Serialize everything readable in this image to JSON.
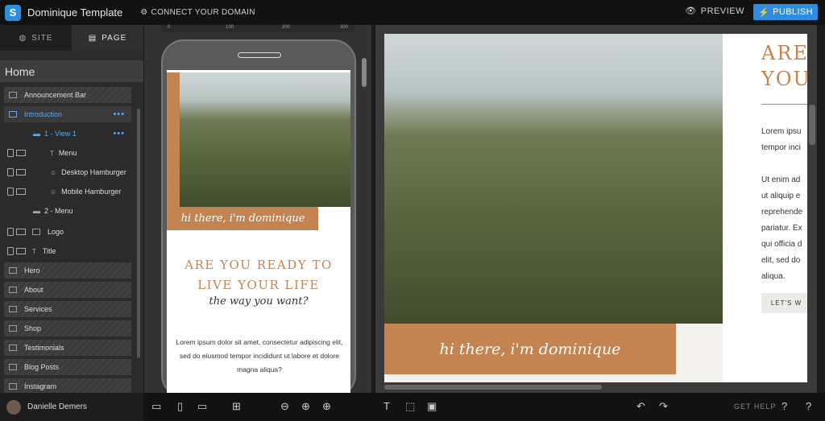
{
  "app": {
    "title": "Dominique Template",
    "connect_label": "CONNECT YOUR DOMAIN",
    "preview_label": "PREVIEW",
    "publish_label": "PUBLISH"
  },
  "sidebar": {
    "tabs": [
      {
        "label": "SITE"
      },
      {
        "label": "PAGE"
      }
    ],
    "page_title": "Home",
    "items": [
      {
        "label": "Announcement Bar"
      },
      {
        "label": "Introduction"
      },
      {
        "label": "1 - View 1"
      },
      {
        "label": "Menu"
      },
      {
        "label": "Desktop Hamburger"
      },
      {
        "label": "Mobile Hamburger"
      },
      {
        "label": "2 - Menu"
      },
      {
        "label": "Logo"
      },
      {
        "label": "Title"
      },
      {
        "label": "Hero"
      },
      {
        "label": "About"
      },
      {
        "label": "Services"
      },
      {
        "label": "Shop"
      },
      {
        "label": "Testimonials"
      },
      {
        "label": "Blog Posts"
      },
      {
        "label": "Instagram"
      }
    ],
    "user_name": "Danielle Demers"
  },
  "ruler": {
    "ticks": [
      "0",
      "100",
      "200",
      "300"
    ]
  },
  "mobile_preview": {
    "script_text": "hi there, i'm dominique",
    "heading_line1": "ARE YOU READY TO",
    "heading_line2": "LIVE YOUR LIFE",
    "subheading": "the way you want?",
    "body": "Lorem ipsum dolor sit amet, consectetur adipiscing elit, sed do eiusmod tempor incididunt ut labore et dolore magna aliqua?"
  },
  "desktop_preview": {
    "script_text": "hi there, i'm dominique",
    "heading_line1": "ARE Y",
    "heading_line2": "YOU",
    "para1": [
      "Lorem ipsu",
      "tempor inci"
    ],
    "para2": [
      "Ut enim ad",
      "ut aliquip e",
      "reprehende",
      "pariatur. Ex",
      "qui officia d",
      "elit, sed do",
      "aliqua."
    ],
    "button_label": "LET'S W"
  },
  "bottom_toolbar": {
    "help_label": "GET HELP"
  },
  "colors": {
    "accent": "#c48452",
    "primary": "#2d8ee0",
    "selection": "#5aa8ec"
  }
}
